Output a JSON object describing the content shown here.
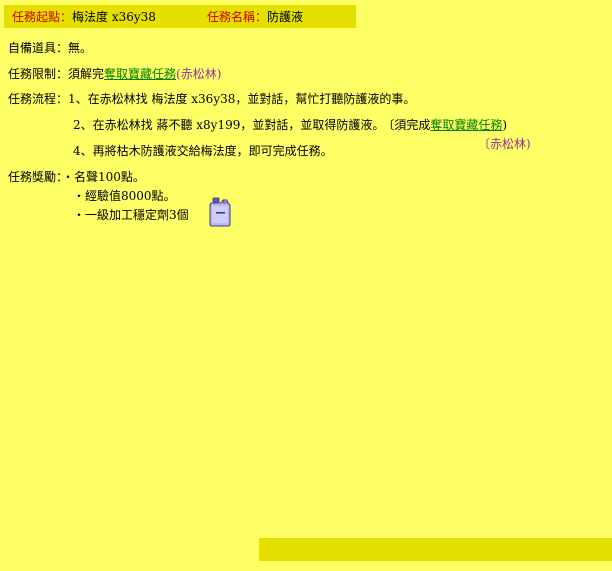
{
  "header": {
    "start_label": "任務起點：",
    "start_value": "梅法度 x36y38",
    "name_label": "任務名稱：",
    "name_value": "防護液"
  },
  "equipment": {
    "label": "自備道具：",
    "value": "無。"
  },
  "restriction": {
    "label": "任務限制：",
    "prefix": "須解完",
    "quest_link": "奪取寶藏任務",
    "location": "(赤松林)"
  },
  "flow": {
    "label": "任務流程：",
    "step1": "1、在赤松林找 梅法度 x36y38，並對話，幫忙打聽防護液的事。",
    "step2_text": "2、在赤松林找 蔣不聽 x8y199，並對話，並取得防護液。",
    "step2_prefix": "〔須完成",
    "step2_link": "奪取寶藏任務",
    "step2_suffix": ")",
    "step2_location": "〔赤松林)",
    "step4": "4、再將枯木防護液交給梅法度，即可完成任務。"
  },
  "reward": {
    "label": "任務獎勵：",
    "item1": "・名聲100點。",
    "item2": "・經驗值8000點。",
    "item3": "・一級加工穩定劑3個",
    "item3_icon": "potion-jug-icon"
  },
  "colors": {
    "background": "#ffff66",
    "bar": "#e5e000",
    "label_red": "#cc0000",
    "link_green": "#008000",
    "location_purple": "#993399"
  }
}
